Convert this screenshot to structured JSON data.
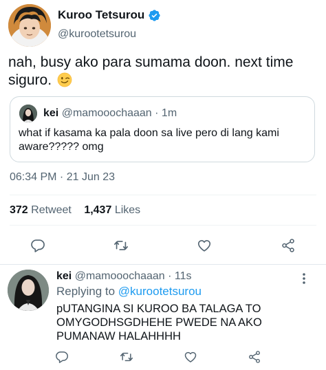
{
  "main_tweet": {
    "author_name": "Kuroo Tetsurou",
    "author_handle": "@kurootetsurou",
    "text": "nah, busy ako para sumama doon. next time siguro.",
    "quoted": {
      "name": "kei",
      "handle": "@mamooochaaan",
      "time": "· 1m",
      "text": "what if kasama ka pala doon sa live pero di lang kami aware????? omg"
    },
    "timestamp": "06:34 PM · 21 Jun 23",
    "stats": {
      "retweets_count": "372",
      "retweets_label": "Retweet",
      "likes_count": "1,437",
      "likes_label": "Likes"
    }
  },
  "reply_tweet": {
    "name": "kei",
    "handle": "@mamooochaaan",
    "time": "· 11s",
    "replying_to_label": "Replying to",
    "replying_to_mention": "@kurootetsurou",
    "text": "pUTANGINA SI KUROO BA TALAGA TO OMYGODHSGDHEHE PWEDE NA AKO PUMANAW HALAHHHH"
  },
  "colors": {
    "verified_blue": "#1d9bf0",
    "secondary_text": "#536471",
    "mention_blue": "#1d9bf0",
    "icon_gray": "#536471"
  },
  "icons": [
    "verified-badge-icon",
    "wink-emoji-icon",
    "reply-icon",
    "retweet-icon",
    "like-icon",
    "share-icon",
    "more-options-icon"
  ]
}
